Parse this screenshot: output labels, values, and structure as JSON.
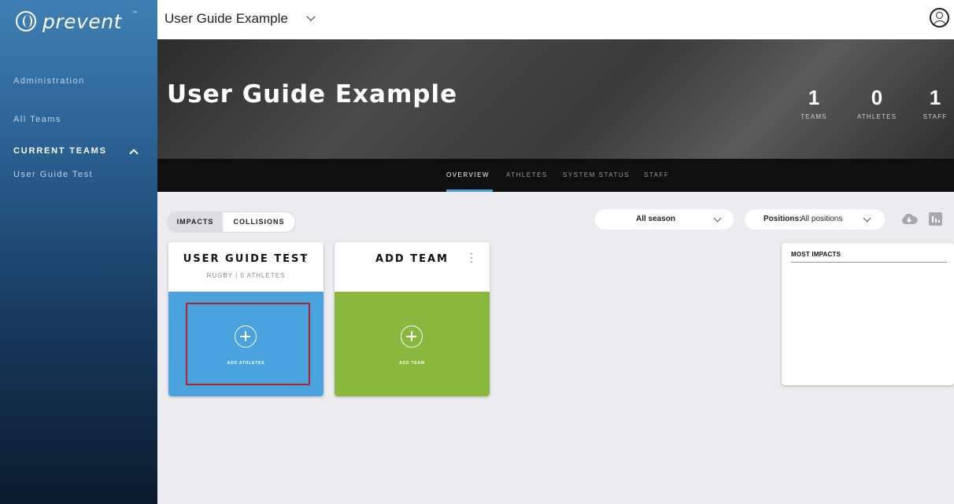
{
  "brand": {
    "name": "prevent",
    "tm": "™"
  },
  "sidebar": {
    "items": [
      {
        "label": "Administration"
      },
      {
        "label": "All Teams"
      }
    ],
    "current_teams_heading": "CURRENT TEAMS",
    "current_teams": [
      {
        "label": "User Guide Test"
      }
    ]
  },
  "topbar": {
    "title": "User Guide Example"
  },
  "hero": {
    "title": "User Guide Example",
    "stats": [
      {
        "value": "1",
        "label": "TEAMS"
      },
      {
        "value": "0",
        "label": "ATHLETES"
      },
      {
        "value": "1",
        "label": "STAFF"
      }
    ]
  },
  "tabs": [
    {
      "label": "OVERVIEW",
      "active": true
    },
    {
      "label": "ATHLETES",
      "active": false
    },
    {
      "label": "SYSTEM STATUS",
      "active": false
    },
    {
      "label": "STAFF",
      "active": false
    }
  ],
  "toggle": {
    "options": [
      {
        "label": "IMPACTS",
        "selected": true
      },
      {
        "label": "COLLISIONS",
        "selected": false
      }
    ]
  },
  "filters": {
    "season": {
      "value": "All season"
    },
    "positions": {
      "label": "Positions:",
      "value": "All positions"
    }
  },
  "cards": [
    {
      "title": "USER GUIDE TEST",
      "subtitle": "RUGBY | 0 ATHLETES",
      "action": "ADD ATHLETES",
      "color": "#4aa3df"
    },
    {
      "title": "ADD TEAM",
      "subtitle": "",
      "action": "ADD TEAM",
      "color": "#8ab83f"
    }
  ],
  "panel": {
    "title": "MOST IMPACTS"
  },
  "icons": [
    "logo-icon",
    "chevron-up-icon",
    "chevron-down-icon",
    "profile-icon",
    "cloud-download-icon",
    "bar-chart-icon",
    "kebab-menu-icon",
    "plus-circle-icon"
  ]
}
